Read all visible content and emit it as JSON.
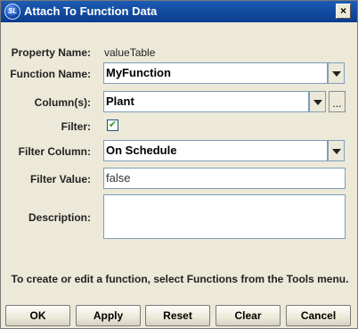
{
  "window": {
    "title": "Attach To Function Data",
    "icon_text": "SL",
    "close_label": "×"
  },
  "form": {
    "property_name": {
      "label": "Property Name:",
      "value": "valueTable"
    },
    "function_name": {
      "label": "Function Name:",
      "value": "MyFunction"
    },
    "columns": {
      "label": "Column(s):",
      "value": "Plant",
      "browse_label": "..."
    },
    "filter": {
      "label": "Filter:",
      "checked": true,
      "check_glyph": "✔"
    },
    "filter_column": {
      "label": "Filter Column:",
      "value": "On Schedule"
    },
    "filter_value": {
      "label": "Filter Value:",
      "value": "false"
    },
    "description": {
      "label": "Description:",
      "value": ""
    }
  },
  "help_text": "To create or edit a function, select Functions from the Tools menu.",
  "buttons": {
    "ok": "OK",
    "apply": "Apply",
    "reset": "Reset",
    "clear": "Clear",
    "cancel": "Cancel"
  }
}
